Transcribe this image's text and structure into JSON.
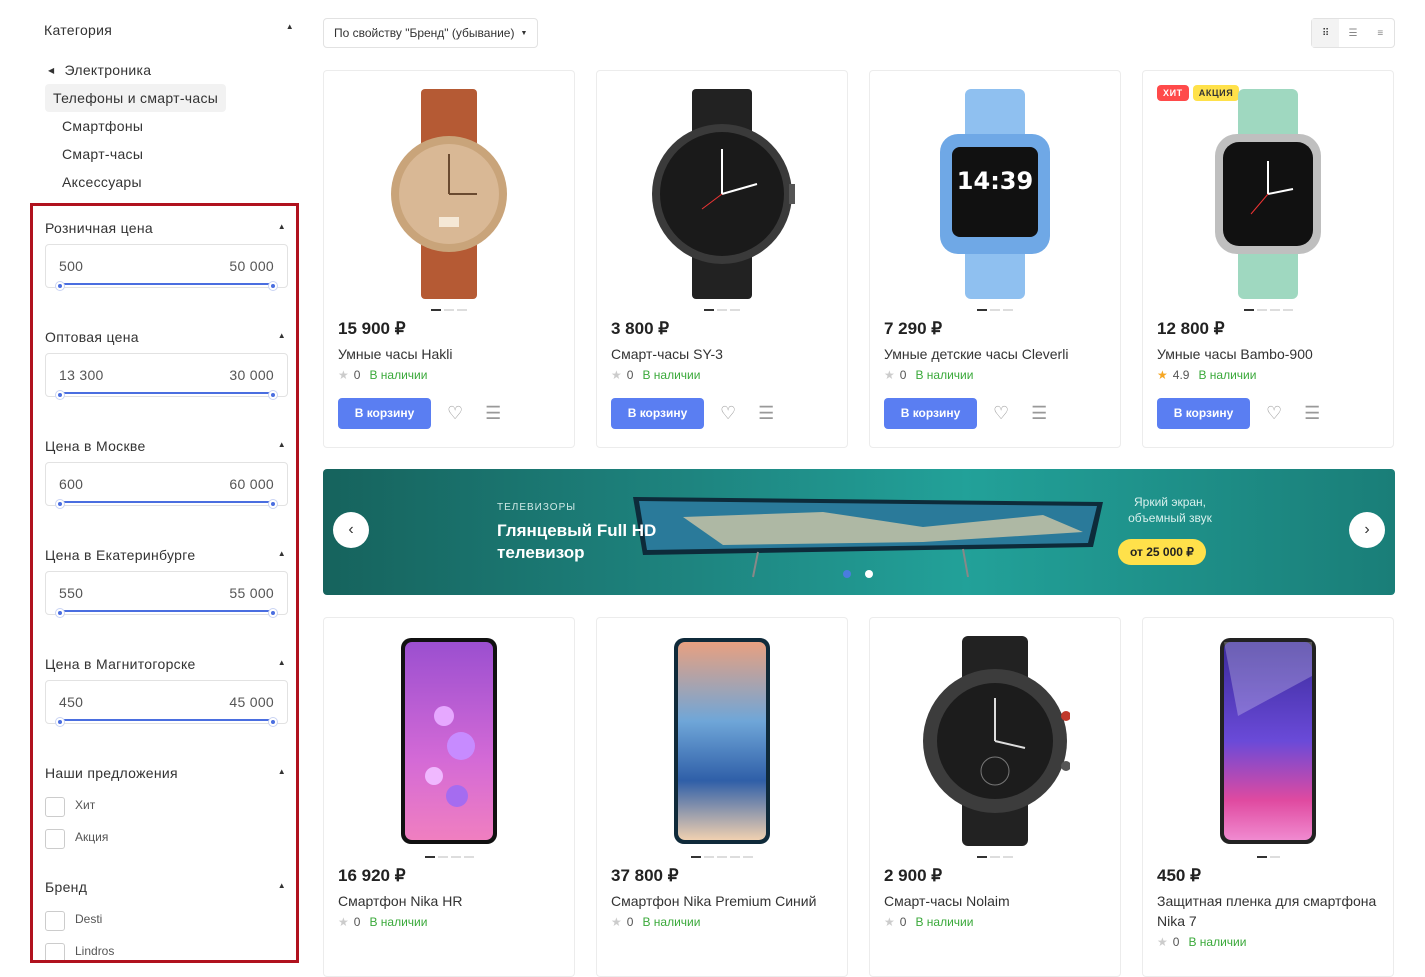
{
  "sidebar": {
    "category_title": "Категория",
    "back_item": "Электроника",
    "active_item": "Телефоны и смарт-часы",
    "sub_items": [
      "Смартфоны",
      "Смарт-часы",
      "Аксессуары"
    ]
  },
  "filters": {
    "ranges": [
      {
        "title": "Розничная цена",
        "min": "500",
        "max": "50 000"
      },
      {
        "title": "Оптовая цена",
        "min": "13 300",
        "max": "30 000"
      },
      {
        "title": "Цена в Москве",
        "min": "600",
        "max": "60 000"
      },
      {
        "title": "Цена в Екатеринбурге",
        "min": "550",
        "max": "55 000"
      },
      {
        "title": "Цена в Магнитогорске",
        "min": "450",
        "max": "45 000"
      }
    ],
    "offers": {
      "title": "Наши предложения",
      "options": [
        "Хит",
        "Акция"
      ]
    },
    "brand": {
      "title": "Бренд",
      "options": [
        "Desti",
        "Lindros"
      ]
    }
  },
  "toolbar": {
    "sort_label": "По свойству \"Бренд\" (убывание)"
  },
  "common": {
    "in_stock": "В наличии",
    "cart_button": "В корзину"
  },
  "products": [
    {
      "price": "15 900 ₽",
      "name": "Умные часы Hakli",
      "rating": "0"
    },
    {
      "price": "3 800 ₽",
      "name": "Смарт-часы SY-3",
      "rating": "0"
    },
    {
      "price": "7 290 ₽",
      "name": "Умные детские часы Cleverli",
      "rating": "0"
    },
    {
      "price": "12 800 ₽",
      "name": "Умные часы Bambo-900",
      "rating": "4.9",
      "badges": [
        "ХИТ",
        "АКЦИЯ"
      ]
    },
    {
      "price": "16 920 ₽",
      "name": "Смартфон Nika HR",
      "rating": "0"
    },
    {
      "price": "37 800 ₽",
      "name": "Смартфон Nika Premium Синий",
      "rating": "0"
    },
    {
      "price": "2 900 ₽",
      "name": "Смарт-часы Nolaim",
      "rating": "0"
    },
    {
      "price": "450 ₽",
      "name": "Защитная пленка для смартфона Nika 7",
      "rating": "0"
    }
  ],
  "banner": {
    "subtitle": "ТЕЛЕВИЗОРЫ",
    "title": "Глянцевый Full HD телевизор",
    "right_text": "Яркий экран, объемный звук",
    "price_badge": "от 25 000 ₽"
  },
  "colors": {
    "accent": "#5a7ef2",
    "in_stock": "#3aa93a",
    "filter_border": "#b0121e",
    "badge_hit": "#ff4a4a",
    "badge_sale": "#ffe14a"
  }
}
